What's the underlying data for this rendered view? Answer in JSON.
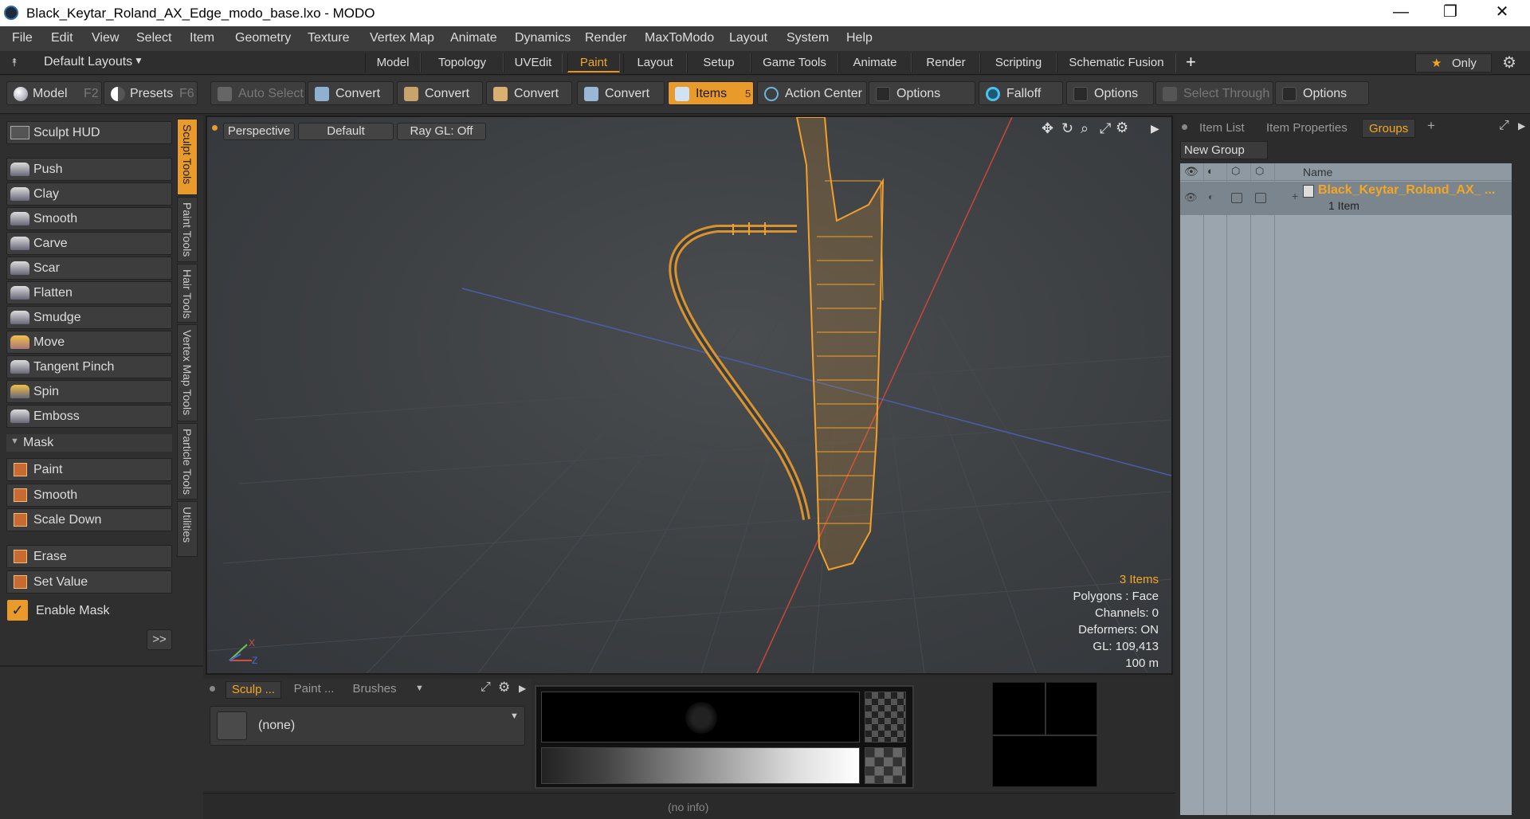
{
  "window": {
    "title": "Black_Keytar_Roland_AX_Edge_modo_base.lxo - MODO",
    "minimize_glyph": "—",
    "restore_glyph": "❐",
    "close_glyph": "✕"
  },
  "menu": [
    "File",
    "Edit",
    "View",
    "Select",
    "Item",
    "Geometry",
    "Texture",
    "Vertex Map",
    "Animate",
    "Dynamics",
    "Render",
    "MaxToModo",
    "Layout",
    "System",
    "Help"
  ],
  "layoutbar": {
    "layouts_label": "Default Layouts",
    "tabs": [
      "Model",
      "Topology",
      "UVEdit",
      "Paint",
      "Layout",
      "Setup",
      "Game Tools",
      "Animate",
      "Render",
      "Scripting",
      "Schematic Fusion"
    ],
    "active_tab": "Paint",
    "plus": "+",
    "only_label": "Only",
    "star": "★",
    "gear": "⚙"
  },
  "toolbar": {
    "model_label": "Model",
    "model_key": "F2",
    "presets_label": "Presets",
    "presets_key": "F6",
    "auto_select": "Auto Select",
    "convert": "Convert",
    "items_label": "Items",
    "items_count": "5",
    "action_center": "Action Center",
    "options": "Options",
    "falloff": "Falloff",
    "select_through": "Select Through"
  },
  "leftpanel": {
    "sculpt_hud": "Sculpt HUD",
    "tools": [
      "Push",
      "Clay",
      "Smooth",
      "Carve",
      "Scar",
      "Flatten",
      "Smudge",
      "Move",
      "Tangent Pinch",
      "Spin",
      "Emboss"
    ],
    "mask_header": "Mask",
    "mask_tools": [
      "Paint",
      "Smooth",
      "Scale Down"
    ],
    "other_tools": [
      "Erase",
      "Set Value"
    ],
    "enable_mask": "Enable Mask",
    "expand": ">>",
    "vtabs": [
      "Sculpt Tools",
      "Paint Tools",
      "Hair Tools",
      "Vertex Map Tools",
      "Particle Tools",
      "Utilities"
    ]
  },
  "viewport": {
    "view_mode": "Perspective",
    "shading": "Default",
    "raygl": "Ray GL: Off",
    "info": {
      "items": "3 Items",
      "polygons": "Polygons : Face",
      "channels": "Channels: 0",
      "deformers": "Deformers: ON",
      "gl": "GL: 109,413",
      "scale": "100 m"
    },
    "axis_x": "X",
    "axis_z": "Z"
  },
  "bottompanel": {
    "tabs": [
      "Sculp ...",
      "Paint ...",
      "Brushes"
    ],
    "preset_value": "(none)"
  },
  "rightpanel": {
    "tabs": [
      "Item List",
      "Item Properties",
      "Groups"
    ],
    "active_tab": "Groups",
    "new_group": "New Group",
    "name_col": "Name",
    "group_name": "Black_Keytar_Roland_AX_ ...",
    "group_count": "1 Item"
  },
  "status": {
    "text": "(no info)"
  },
  "colors": {
    "accent": "#e89a2a",
    "model_wire": "#f2a02a"
  }
}
